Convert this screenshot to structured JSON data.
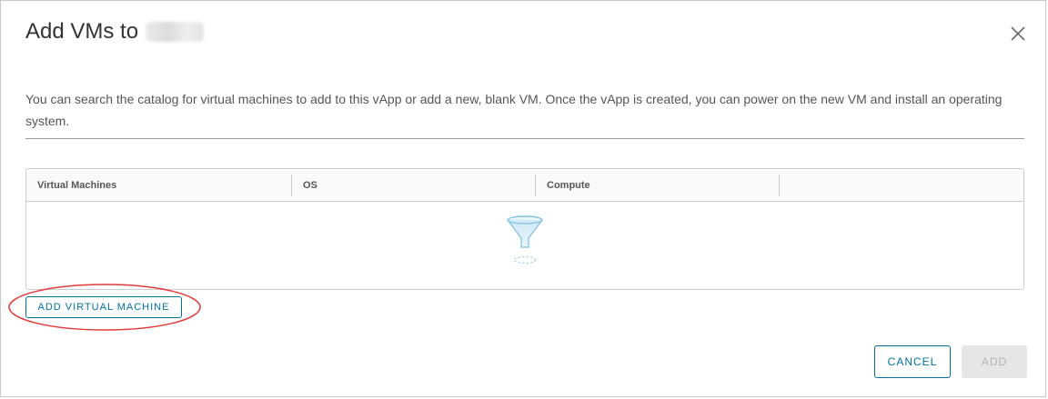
{
  "dialog": {
    "title": "Add VMs to",
    "close_icon": "close-icon",
    "description": "You can search the catalog for virtual machines to add to this vApp or add a new, blank VM. Once the vApp is created, you can power on the new VM and install an operating system."
  },
  "grid": {
    "columns": [
      "Virtual Machines",
      "OS",
      "Compute",
      ""
    ],
    "rows": [],
    "empty_icon": "empty-filter-icon"
  },
  "buttons": {
    "add_virtual_machine": "ADD VIRTUAL MACHINE",
    "cancel": "CANCEL",
    "add": "ADD"
  },
  "colors": {
    "primary": "#0072a3",
    "annotation": "#e03c3c",
    "disabled_bg": "#e6e6e6",
    "disabled_text": "#b3b3b3"
  }
}
